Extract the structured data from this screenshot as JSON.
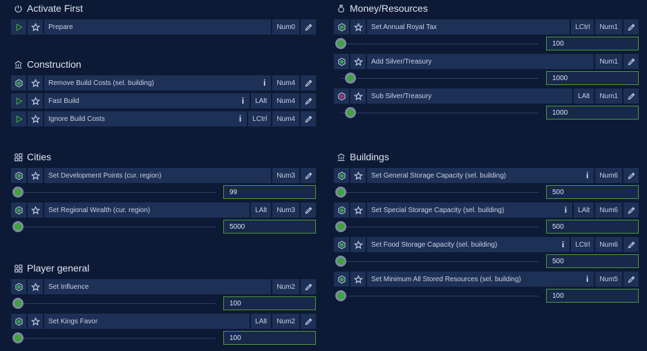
{
  "left": {
    "sections": [
      {
        "id": "activate",
        "title": "Activate First",
        "icon": "power-icon",
        "rows": [
          {
            "action": "play",
            "name": "Prepare",
            "info": false,
            "keys": [
              "Num0"
            ]
          }
        ]
      },
      {
        "id": "construction",
        "title": "Construction",
        "icon": "building-icon",
        "rows": [
          {
            "action": "toggle",
            "name": "Remove Build Costs (sel. building)",
            "info": true,
            "keys": [
              "Num4"
            ]
          },
          {
            "action": "play",
            "name": "Fast Build",
            "info": true,
            "keys": [
              "LAlt",
              "Num4"
            ]
          },
          {
            "action": "play",
            "name": "Ignore Build Costs",
            "info": true,
            "keys": [
              "LCtrl",
              "Num4"
            ]
          }
        ]
      },
      {
        "id": "cities",
        "title": "Cities",
        "icon": "grid-icon",
        "rows": [
          {
            "action": "toggle",
            "name": "Set Development Points (cur. region)",
            "info": false,
            "keys": [
              "Num3"
            ],
            "slider": {
              "value": "99",
              "fraction": 0.0
            }
          },
          {
            "action": "toggle",
            "name": "Set Regional Wealth (cur. region)",
            "info": false,
            "keys": [
              "LAlt",
              "Num3"
            ],
            "slider": {
              "value": "5000",
              "fraction": 0.0
            }
          }
        ]
      },
      {
        "id": "player",
        "title": "Player general",
        "icon": "grid-icon",
        "rows": [
          {
            "action": "toggle",
            "name": "Set Influence",
            "info": false,
            "keys": [
              "Num2"
            ],
            "slider": {
              "value": "100",
              "fraction": 0.0
            }
          },
          {
            "action": "toggle",
            "name": "Set Kings Favor",
            "info": false,
            "keys": [
              "LAlt",
              "Num2"
            ],
            "slider": {
              "value": "100",
              "fraction": 0.0
            }
          }
        ]
      }
    ]
  },
  "right": {
    "sections": [
      {
        "id": "money",
        "title": "Money/Resources",
        "icon": "money-bag-icon",
        "rows": [
          {
            "action": "toggle",
            "name": "Set Annual Royal Tax",
            "info": false,
            "keys": [
              "LCtrl",
              "Num1"
            ],
            "slider": {
              "value": "100",
              "fraction": 0.0
            }
          },
          {
            "action": "toggle",
            "name": "Add Silver/Treasury",
            "info": false,
            "keys": [
              "Num1"
            ],
            "slider": {
              "value": "1000",
              "fraction": 0.05
            }
          },
          {
            "action": "toggle-red",
            "name": "Sub Silver/Treasury",
            "info": false,
            "keys": [
              "LAlt",
              "Num1"
            ],
            "slider": {
              "value": "1000",
              "fraction": 0.05
            }
          }
        ]
      },
      {
        "id": "buildings",
        "title": "Buildings",
        "icon": "building-icon",
        "rows": [
          {
            "action": "toggle",
            "name": "Set General Storage Capacity (sel. building)",
            "info": true,
            "keys": [
              "Num6"
            ],
            "slider": {
              "value": "500",
              "fraction": 0.0
            }
          },
          {
            "action": "toggle",
            "name": "Set Special Storage Capacity (sel. building)",
            "info": true,
            "keys": [
              "LAlt",
              "Num6"
            ],
            "slider": {
              "value": "500",
              "fraction": 0.0
            }
          },
          {
            "action": "toggle",
            "name": "Set Food Storage Capacity (sel. building)",
            "info": true,
            "keys": [
              "LCtrl",
              "Num6"
            ],
            "slider": {
              "value": "500",
              "fraction": 0.0
            }
          },
          {
            "action": "toggle",
            "name": "Set Minimum All Stored Resources (sel. building)",
            "info": true,
            "keys": [
              "Num5"
            ],
            "slider": {
              "value": "100",
              "fraction": 0.0
            }
          }
        ]
      }
    ]
  },
  "info_glyph": "i",
  "colors": {
    "play": "#3ea43a",
    "toggle": "#2fa24a",
    "toggle_red": "#b0306a",
    "slider_border": "#4f9a3a"
  }
}
